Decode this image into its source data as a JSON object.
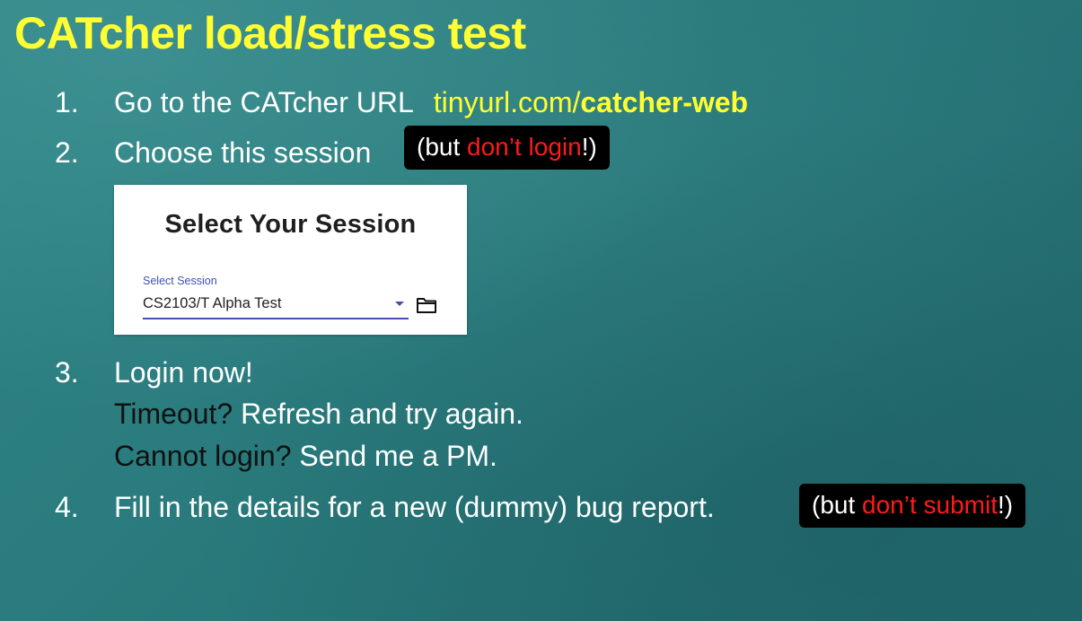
{
  "slide": {
    "title": "CATcher load/stress test",
    "steps": [
      {
        "number": "1.",
        "text": "Go to the CATcher URL",
        "url_prefix": "tinyurl.com/",
        "url_bold": "catcher-web"
      },
      {
        "number": "2.",
        "text": "Choose this session",
        "note_open": "(but ",
        "note_red": "don’t login",
        "note_close": "!)"
      },
      {
        "number": "3.",
        "line1": "Login now!",
        "line2_dark": "Timeout?",
        "line2_rest": " Refresh and try again.",
        "line3_dark": "Cannot login?",
        "line3_rest": " Send me a PM."
      },
      {
        "number": "4.",
        "text": "Fill in the details for a new (dummy) bug report.",
        "note_open": "(but ",
        "note_red": "don’t submit",
        "note_close": "!)"
      }
    ]
  },
  "session_card": {
    "title": "Select Your Session",
    "field_label": "Select Session",
    "selected_value": "CS2103/T Alpha Test",
    "icons": {
      "dropdown": "arrow-drop-down-icon",
      "folder": "folder-icon"
    }
  },
  "colors": {
    "title_yellow": "#ffff33",
    "warning_red": "#ff1a1a",
    "accent_indigo": "#3f51b5",
    "background_teal": "#2a7b7d"
  }
}
